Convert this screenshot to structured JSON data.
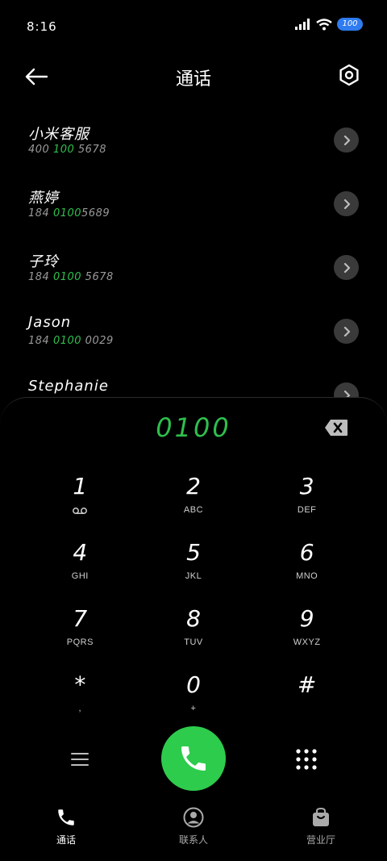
{
  "status_bar": {
    "time": "8:16",
    "battery": "100"
  },
  "header": {
    "title": "通话"
  },
  "contacts": [
    {
      "name": "小米客服",
      "number_pre": "400 ",
      "number_hl": "100",
      "number_post": " 5678"
    },
    {
      "name": "燕婷",
      "number_pre": "184 ",
      "number_hl": "0100",
      "number_post": "5689"
    },
    {
      "name": "子玲",
      "number_pre": "184 ",
      "number_hl": "0100",
      "number_post": " 5678"
    },
    {
      "name": "Jason",
      "number_pre": "184 ",
      "number_hl": "0100",
      "number_post": " 0029"
    },
    {
      "name": "Stephanie",
      "number_pre": "",
      "number_hl": "",
      "number_post": ""
    }
  ],
  "dialer": {
    "input": "0100",
    "keys": [
      {
        "digit": "1",
        "letters": ""
      },
      {
        "digit": "2",
        "letters": "ABC"
      },
      {
        "digit": "3",
        "letters": "DEF"
      },
      {
        "digit": "4",
        "letters": "GHI"
      },
      {
        "digit": "5",
        "letters": "JKL"
      },
      {
        "digit": "6",
        "letters": "MNO"
      },
      {
        "digit": "7",
        "letters": "PQRS"
      },
      {
        "digit": "8",
        "letters": "TUV"
      },
      {
        "digit": "9",
        "letters": "WXYZ"
      },
      {
        "digit": "*",
        "letters": ","
      },
      {
        "digit": "0",
        "letters": "+"
      },
      {
        "digit": "#",
        "letters": ""
      }
    ]
  },
  "bottom_nav": [
    {
      "label": "通话",
      "icon": "phone-icon",
      "active": true
    },
    {
      "label": "联系人",
      "icon": "contact-icon",
      "active": false
    },
    {
      "label": "营业厅",
      "icon": "bag-icon",
      "active": false
    }
  ],
  "colors": {
    "accent": "#2fbf4d",
    "call_button": "#2ecc4c",
    "battery": "#2f7bf0"
  }
}
